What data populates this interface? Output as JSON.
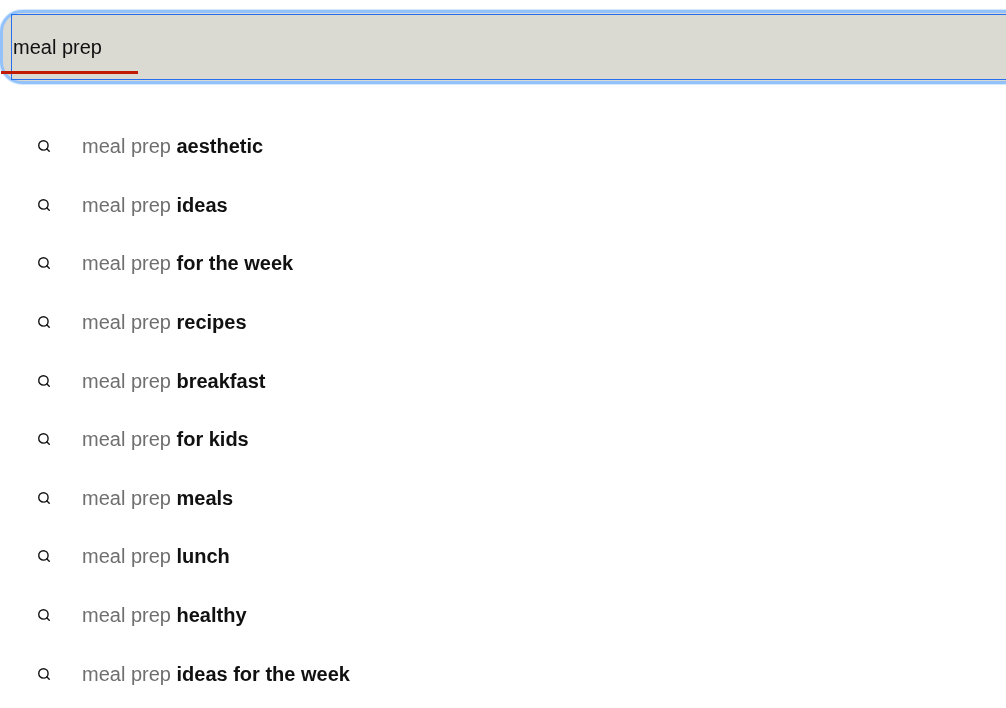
{
  "search": {
    "value": "meal prep",
    "focused": true,
    "misspelled": true
  },
  "suggestions": [
    {
      "text": "meal prep **aesthetic**"
    },
    {
      "text": "meal prep **ideas**"
    },
    {
      "text": "meal prep **for the week**"
    },
    {
      "text": "meal prep **recipes**"
    },
    {
      "text": "meal prep **breakfast**"
    },
    {
      "text": "meal prep **for kids**"
    },
    {
      "text": "meal prep **meals**"
    },
    {
      "text": "meal prep **lunch**"
    },
    {
      "text": "meal prep **healthy**"
    },
    {
      "text": "meal prep **ideas for the week**"
    }
  ]
}
